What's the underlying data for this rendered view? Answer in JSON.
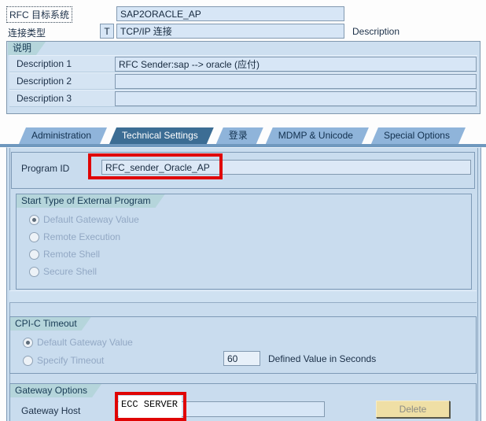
{
  "colors": {
    "accent_red": "#E00404",
    "active_tab": "#3C6D94",
    "inactive_tab": "#8FB4DA",
    "panel_bg": "#C9DCEE",
    "group_header_bg": "#B5D5DB",
    "field_bg": "#D7E6F6",
    "delete_button_bg": "#EFDFA5"
  },
  "header": {
    "rfc_label": "RFC 目标系统",
    "rfc_value": "SAP2ORACLE_AP",
    "conn_type_label": "连接类型",
    "conn_type_code": "T",
    "conn_type_value": "TCP/IP 连接",
    "description_label": "Description"
  },
  "description_group": {
    "title": "说明",
    "rows": [
      {
        "label": "Description 1",
        "value": "RFC Sender:sap --> oracle (应付)"
      },
      {
        "label": "Description 2",
        "value": ""
      },
      {
        "label": "Description 3",
        "value": ""
      }
    ]
  },
  "tabs": [
    {
      "label": "Administration"
    },
    {
      "label": "Technical Settings"
    },
    {
      "label": "登录"
    },
    {
      "label": "MDMP & Unicode"
    },
    {
      "label": "Special Options"
    }
  ],
  "technical_settings": {
    "program_id_label": "Program ID",
    "program_id_value": "RFC_sender_Oracle_AP",
    "start_type": {
      "title": "Start Type of External Program",
      "options": [
        {
          "label": "Default Gateway Value",
          "selected": true
        },
        {
          "label": "Remote Execution",
          "selected": false
        },
        {
          "label": "Remote Shell",
          "selected": false
        },
        {
          "label": "Secure Shell",
          "selected": false
        }
      ]
    },
    "cpic": {
      "title": "CPI-C Timeout",
      "options": [
        {
          "label": "Default Gateway Value",
          "selected": true
        },
        {
          "label": "Specify Timeout",
          "selected": false
        }
      ],
      "timeout_value": "60",
      "timeout_unit_label": "Defined Value in Seconds"
    },
    "gateway": {
      "title": "Gateway Options",
      "host_label": "Gateway Host",
      "host_value": "",
      "host_annotation": "ECC SERVER",
      "delete_label": "Delete"
    }
  }
}
